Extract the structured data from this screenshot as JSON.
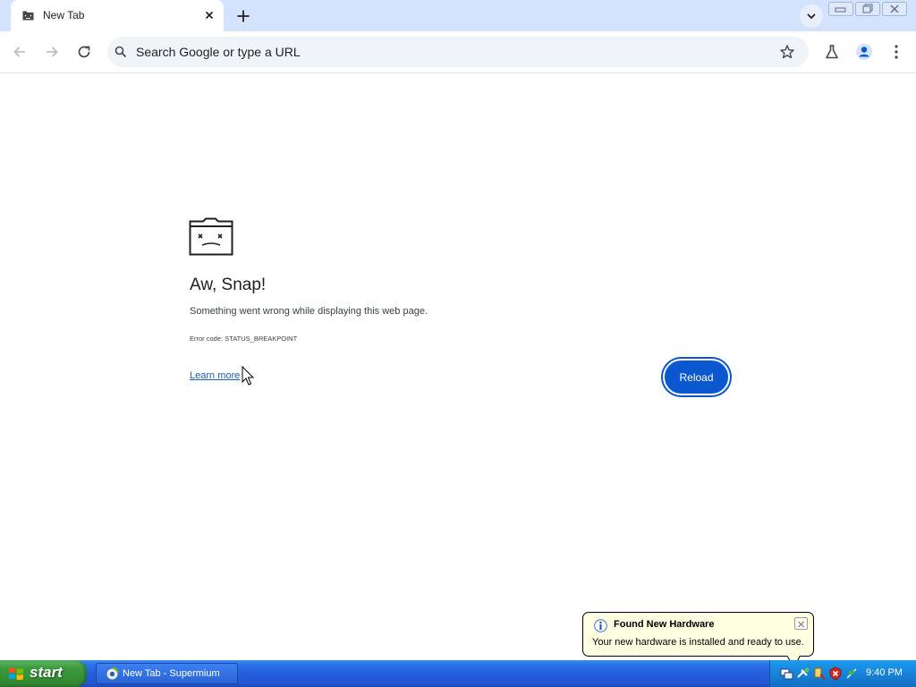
{
  "browser": {
    "tab_title": "New Tab",
    "omnibox_placeholder": "Search Google or type a URL"
  },
  "error_page": {
    "title": "Aw, Snap!",
    "message": "Something went wrong while displaying this web page.",
    "error_code": "Error code: STATUS_BREAKPOINT",
    "learn_more": "Learn more",
    "reload_label": "Reload"
  },
  "balloon": {
    "title": "Found New Hardware",
    "text": "Your new hardware is installed and ready to use."
  },
  "taskbar": {
    "start_label": "start",
    "task_label": "New Tab - Supermium",
    "clock": "9:40 PM"
  },
  "colors": {
    "tabstrip_bg": "#d3e3fd",
    "reload_blue": "#0b57d0",
    "taskbar_blue": "#245edb",
    "start_green": "#348f33",
    "balloon_bg": "#ffffe1"
  },
  "icons": {
    "tab_favicon": "sad-tab-icon",
    "tab_close": "close-icon",
    "new_tab": "plus-icon",
    "back": "back-arrow-icon",
    "forward": "forward-arrow-icon",
    "reload": "reload-icon",
    "search": "search-icon",
    "bookmark": "star-icon",
    "labs": "flask-icon",
    "profile": "profile-icon",
    "menu": "kebab-menu-icon"
  }
}
